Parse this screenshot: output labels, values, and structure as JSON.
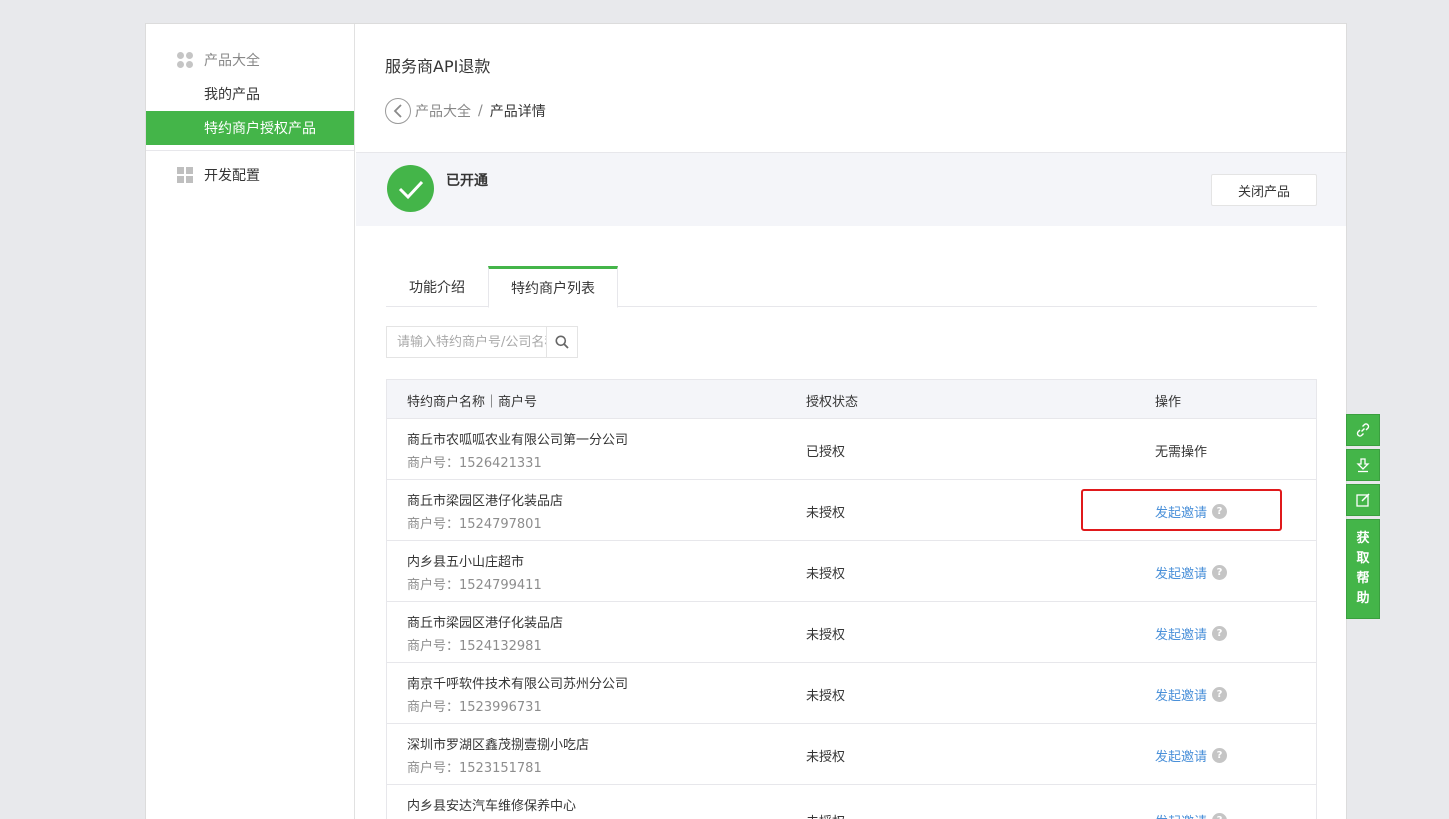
{
  "sidebar": {
    "group_products": "产品大全",
    "items": [
      {
        "label": "我的产品",
        "active": false
      },
      {
        "label": "特约商户授权产品",
        "active": true
      }
    ],
    "group_dev": "开发配置"
  },
  "header": {
    "title": "服务商API退款",
    "breadcrumb": {
      "parent": "产品大全",
      "separator": "/",
      "current": "产品详情"
    }
  },
  "status": {
    "label": "已开通",
    "close_button": "关闭产品"
  },
  "tabs": [
    {
      "label": "功能介绍",
      "active": false
    },
    {
      "label": "特约商户列表",
      "active": true
    }
  ],
  "search": {
    "placeholder": "请输入特约商户号/公司名称查询",
    "value": ""
  },
  "table": {
    "headers": [
      "特约商户名称｜商户号",
      "授权状态",
      "操作"
    ],
    "mch_prefix": "商户号：",
    "rows": [
      {
        "name": "商丘市农呱呱农业有限公司第一分公司",
        "mch": "商户号：1526421331",
        "status": "已授权",
        "action": "无需操作",
        "link": false
      },
      {
        "name": "商丘市梁园区港仔化装品店",
        "mch": "商户号：1524797801",
        "status": "未授权",
        "action": "发起邀请",
        "link": true
      },
      {
        "name": "内乡县五小山庄超市",
        "mch": "商户号：1524799411",
        "status": "未授权",
        "action": "发起邀请",
        "link": true
      },
      {
        "name": "商丘市梁园区港仔化装品店",
        "mch": "商户号：1524132981",
        "status": "未授权",
        "action": "发起邀请",
        "link": true
      },
      {
        "name": "南京千呼软件技术有限公司苏州分公司",
        "mch": "商户号：1523996731",
        "status": "未授权",
        "action": "发起邀请",
        "link": true
      },
      {
        "name": "深圳市罗湖区鑫茂捌壹捌小吃店",
        "mch": "商户号：1523151781",
        "status": "未授权",
        "action": "发起邀请",
        "link": true
      },
      {
        "name": "内乡县安达汽车维修保养中心",
        "mch": "",
        "status": "未授权",
        "action": "发起邀请",
        "link": true
      }
    ]
  },
  "float_help": {
    "label": [
      "获",
      "取",
      "帮",
      "助"
    ]
  },
  "colors": {
    "accent": "#44b549",
    "link": "#4a90d9",
    "highlight": "#e0191b"
  }
}
